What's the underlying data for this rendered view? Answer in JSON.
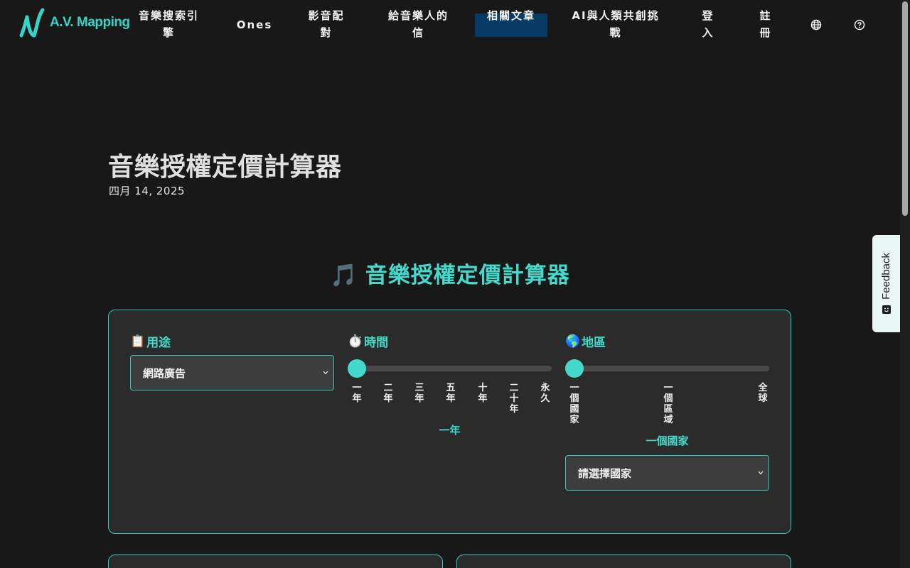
{
  "nav": {
    "logo_text": "A.V. Mapping",
    "items": [
      {
        "label": "音樂搜索引擎",
        "active": false
      },
      {
        "label": "Ones",
        "active": false
      },
      {
        "label": "影音配對",
        "active": false
      },
      {
        "label": "給音樂人的信",
        "active": false
      },
      {
        "label": "相關文章",
        "active": true
      },
      {
        "label": "AI與人類共創挑戰",
        "active": false
      },
      {
        "label": "登入",
        "active": false
      },
      {
        "label": "註冊",
        "active": false
      }
    ],
    "icons": [
      "globe-icon",
      "help-icon"
    ]
  },
  "article": {
    "title": "音樂授權定價計算器",
    "date": "四月 14, 2025"
  },
  "calculator": {
    "heading_emoji": "🎵",
    "heading": "音樂授權定價計算器",
    "usage": {
      "emoji": "📋",
      "label": "用途",
      "selected": "網路廣告"
    },
    "time": {
      "emoji": "⏱️",
      "label": "時間",
      "ticks": [
        "一年",
        "二年",
        "三年",
        "五年",
        "十年",
        "二十年",
        "永久"
      ],
      "value": "一年",
      "position": 0
    },
    "region": {
      "emoji": "🌎",
      "label": "地區",
      "ticks": [
        "一個國家",
        "一個區域",
        "全球"
      ],
      "value": "一個國家",
      "position": 0,
      "country_placeholder": "請選擇國家"
    }
  },
  "feedback": {
    "label": "Feedback"
  },
  "colors": {
    "accent": "#44d9cc",
    "background": "#181819",
    "panel": "#2b2b2b",
    "nav_active": "#083b63"
  }
}
